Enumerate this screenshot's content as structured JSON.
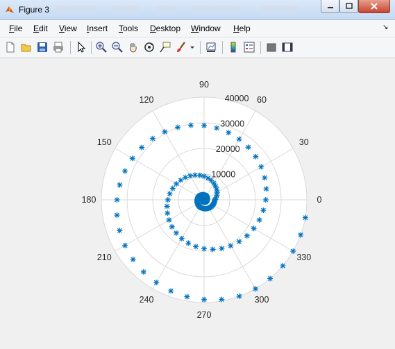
{
  "window": {
    "title": "Figure 3",
    "controls": {
      "minimize": "minimize",
      "maximize": "maximize",
      "close": "close"
    }
  },
  "menu": {
    "items": [
      "File",
      "Edit",
      "View",
      "Insert",
      "Tools",
      "Desktop",
      "Window",
      "Help"
    ]
  },
  "toolbar": {
    "icons": [
      "new-figure-icon",
      "open-file-icon",
      "save-icon",
      "print-icon",
      "pointer-icon",
      "zoom-in-icon",
      "zoom-out-icon",
      "pan-icon",
      "rotate-3d-icon",
      "data-cursor-icon",
      "brush-icon",
      "brush-dropdown-icon",
      "link-plot-icon",
      "insert-colorbar-icon",
      "insert-legend-icon",
      "hide-plot-tools-icon",
      "show-plot-tools-icon"
    ]
  },
  "colors": {
    "marker": "#0072bd",
    "grid": "#d9d9d9",
    "axes_bg": "#ffffff",
    "figure_bg": "#f0f0f0"
  },
  "chart_data": {
    "type": "scatter",
    "coordinate_system": "polar",
    "marker": "*",
    "theta_unit": "degrees",
    "theta_ticks": [
      "0",
      "30",
      "60",
      "90",
      "120",
      "150",
      "180",
      "210",
      "240",
      "270",
      "300",
      "330"
    ],
    "r_ticks": [
      "10000",
      "20000",
      "30000",
      "40000"
    ],
    "rlim": [
      0,
      40000
    ],
    "grid": true,
    "series": [
      {
        "points": {
          "theta_deg": [
            0,
            6,
            12,
            18,
            24,
            30,
            36,
            42,
            48,
            54,
            60,
            66,
            72,
            78,
            84,
            90,
            96,
            102,
            108,
            114,
            120,
            126,
            132,
            138,
            144,
            150,
            156,
            162,
            168,
            174,
            180,
            186,
            192,
            198,
            204,
            210,
            216,
            222,
            228,
            234,
            240,
            246,
            252,
            258,
            264,
            270,
            276,
            282,
            288,
            294,
            300,
            306,
            312,
            318,
            324,
            330,
            336,
            342,
            348,
            354,
            0,
            6,
            12,
            18,
            24,
            30,
            36,
            42,
            48,
            54,
            60,
            66,
            72,
            78,
            84,
            90,
            96,
            102,
            108,
            114,
            120,
            126,
            132,
            138,
            144,
            150,
            156,
            162,
            168,
            174,
            180,
            186,
            192,
            198,
            204,
            210,
            216,
            222,
            228,
            234,
            240,
            246,
            252,
            258,
            264,
            270,
            276,
            282,
            288,
            294,
            300,
            306,
            312,
            318,
            324,
            330,
            336,
            342,
            348,
            354,
            0,
            10,
            20,
            30,
            40,
            50,
            60,
            70,
            80,
            90,
            100,
            110,
            120,
            130,
            140,
            150,
            160,
            170,
            180,
            190,
            200,
            210,
            220,
            230,
            240,
            250,
            260,
            270,
            280,
            290,
            300,
            310,
            320,
            330,
            340,
            350,
            0,
            10,
            20,
            30,
            40,
            50,
            60,
            70,
            80,
            90,
            100,
            110,
            120,
            130,
            140,
            150,
            160,
            170,
            180,
            190,
            200,
            210,
            220,
            230,
            240,
            250,
            260,
            270,
            280,
            290,
            300,
            310,
            320,
            330,
            340,
            350
          ],
          "r": [
            0,
            20,
            40,
            60,
            80,
            100,
            120,
            140,
            160,
            180,
            200,
            220,
            240,
            260,
            280,
            300,
            320,
            340,
            360,
            380,
            400,
            420,
            440,
            460,
            480,
            500,
            520,
            540,
            560,
            580,
            600,
            620,
            640,
            660,
            680,
            700,
            720,
            740,
            760,
            780,
            800,
            820,
            840,
            860,
            880,
            900,
            920,
            940,
            960,
            980,
            1000,
            1020,
            1040,
            1060,
            1080,
            1100,
            1120,
            1140,
            1160,
            1180,
            1200,
            1250,
            1300,
            1350,
            1400,
            1450,
            1500,
            1550,
            1600,
            1650,
            1700,
            1750,
            1800,
            1850,
            1900,
            1950,
            2000,
            2050,
            2100,
            2150,
            2200,
            2250,
            2300,
            2350,
            2400,
            2450,
            2500,
            2550,
            2600,
            2650,
            2700,
            2750,
            2800,
            2850,
            2900,
            2950,
            3000,
            3050,
            3100,
            3150,
            3200,
            3250,
            3300,
            3350,
            3400,
            3450,
            3500,
            3550,
            3600,
            3650,
            3700,
            3750,
            3800,
            3850,
            3900,
            3950,
            4000,
            4050,
            4100,
            4150,
            4200,
            4750,
            5300,
            5850,
            6400,
            6950,
            7500,
            8050,
            8600,
            9150,
            9700,
            10250,
            10800,
            11350,
            11900,
            12450,
            13000,
            13550,
            14100,
            14650,
            15200,
            15750,
            16300,
            16850,
            17400,
            17950,
            18500,
            19050,
            19600,
            20150,
            20700,
            21250,
            21800,
            22350,
            22900,
            23450,
            24000,
            24550,
            25100,
            25650,
            26200,
            26750,
            27300,
            27850,
            28400,
            28950,
            29500,
            30050,
            30600,
            31150,
            31700,
            32250,
            32800,
            33350,
            33900,
            34450,
            35000,
            35550,
            36100,
            36650,
            37200,
            37750,
            38300,
            38850,
            39400,
            39950,
            40500,
            41050,
            41600,
            42150,
            42700,
            43250
          ]
        }
      }
    ]
  }
}
